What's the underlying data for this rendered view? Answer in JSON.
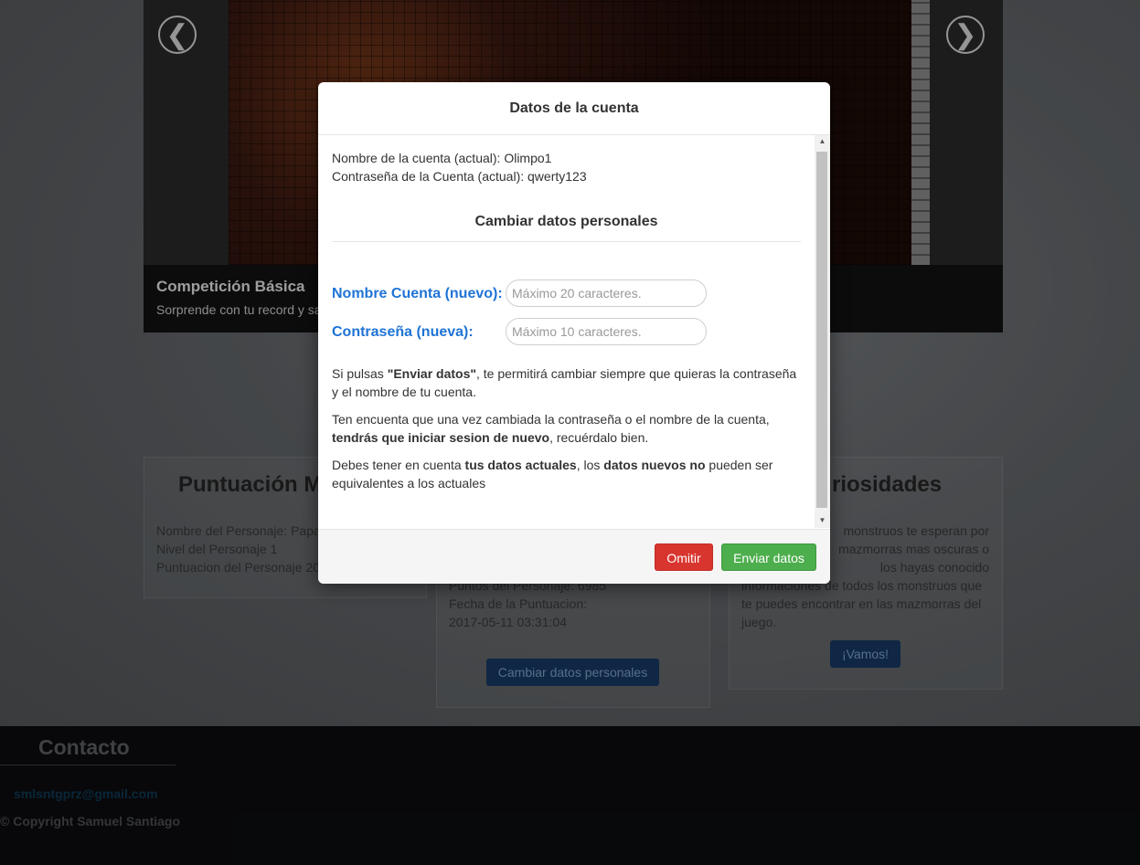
{
  "carousel": {
    "prev_arrow": "❮",
    "next_arrow": "❯",
    "caption_title": "Competición Básica",
    "caption_text": "Sorprende con tu record y sa"
  },
  "panels": {
    "left": {
      "heading": "Puntuación M",
      "lines": [
        "Nombre del Personaje: Papa",
        "Nivel del Personaje 1",
        "Puntuacion del Personaje 20"
      ]
    },
    "middle": {
      "lines": [
        "Puntos del Personaje: 6985",
        "Fecha de la Puntuacion:",
        "2017-05-11 03:31:04"
      ],
      "button": "Cambiar datos personales"
    },
    "right": {
      "heading": "riosidades",
      "lines": [
        "monstruos te esperan por",
        "mazmorras mas oscuras o",
        "los hayas conocido",
        "informaciones de todos los monstruos que",
        "te puedes encontrar en las mazmorras del",
        "juego."
      ],
      "button": "¡Vamos!"
    }
  },
  "footer": {
    "heading": "Contacto",
    "email": "smlsntgprz@gmail.com",
    "copyright": "© Copyright Samuel Santiago"
  },
  "modal": {
    "title": "Datos de la cuenta",
    "current_name": "Nombre de la cuenta (actual): Olimpo1",
    "current_pass": "Contraseña de la Cuenta (actual): qwerty123",
    "subheading": "Cambiar datos personales",
    "name_label": "Nombre Cuenta (nuevo):",
    "name_placeholder": "Máximo 20 caracteres.",
    "pass_label": "Contraseña (nueva):",
    "pass_placeholder": "Máximo 10 caracteres.",
    "para1": {
      "a": "Si pulsas ",
      "b": "\"Enviar datos\"",
      "c": ", te permitirá cambiar siempre que quieras la contraseña y el nombre de tu cuenta."
    },
    "para2": {
      "a": "Ten encuenta que una vez cambiada la contraseña o el nombre de la cuenta, ",
      "b": "tendrás que iniciar sesion de nuevo",
      "c": ", recuérdalo bien."
    },
    "para3": {
      "a": "Debes tener en cuenta ",
      "b": "tus datos actuales",
      "c": ", los ",
      "d": "datos nuevos no",
      "e": " pueden ser equivalentes a los actuales"
    },
    "omit_button": "Omitir",
    "submit_button": "Enviar datos"
  },
  "colors": {
    "label_blue": "#1f74d6",
    "danger": "#d9352f",
    "success": "#4cae4c"
  }
}
